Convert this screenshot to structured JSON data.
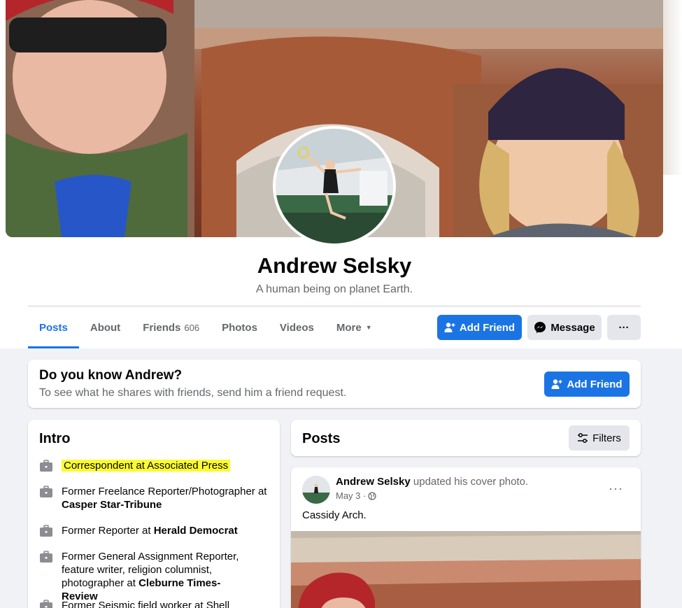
{
  "profile": {
    "name": "Andrew Selsky",
    "bio": "A human being on planet Earth."
  },
  "tabs": [
    {
      "label": "Posts",
      "active": true
    },
    {
      "label": "About"
    },
    {
      "label": "Friends",
      "count": "606"
    },
    {
      "label": "Photos"
    },
    {
      "label": "Videos"
    },
    {
      "label": "More"
    }
  ],
  "actions": {
    "add_friend": "Add Friend",
    "message": "Message",
    "more": "···"
  },
  "know_card": {
    "title": "Do you know Andrew?",
    "subtitle": "To see what he shares with friends, send him a friend request.",
    "button": "Add Friend"
  },
  "intro": {
    "title": "Intro",
    "items": [
      {
        "text": "Correspondent at Associated Press"
      },
      {
        "prefix": "Former Freelance Reporter/Photographer at ",
        "bold": "Casper Star-Tribune"
      },
      {
        "prefix": "Former Reporter at ",
        "bold": "Herald Democrat"
      },
      {
        "prefix": "Former General Assignment Reporter, feature writer, religion columnist, photographer at ",
        "bold": "Cleburne Times-Review"
      },
      {
        "prefix": "Former Seismic field worker at Shell"
      }
    ]
  },
  "posts_header": {
    "title": "Posts",
    "filters": "Filters"
  },
  "post": {
    "author": "Andrew Selsky",
    "action": " updated his cover photo.",
    "date": "May 3 ·",
    "text": "Cassidy Arch.",
    "dots": "···"
  },
  "colors": {
    "accent": "#1b74e4",
    "highlight": "#fbfb2e",
    "background": "#f0f2f5"
  }
}
